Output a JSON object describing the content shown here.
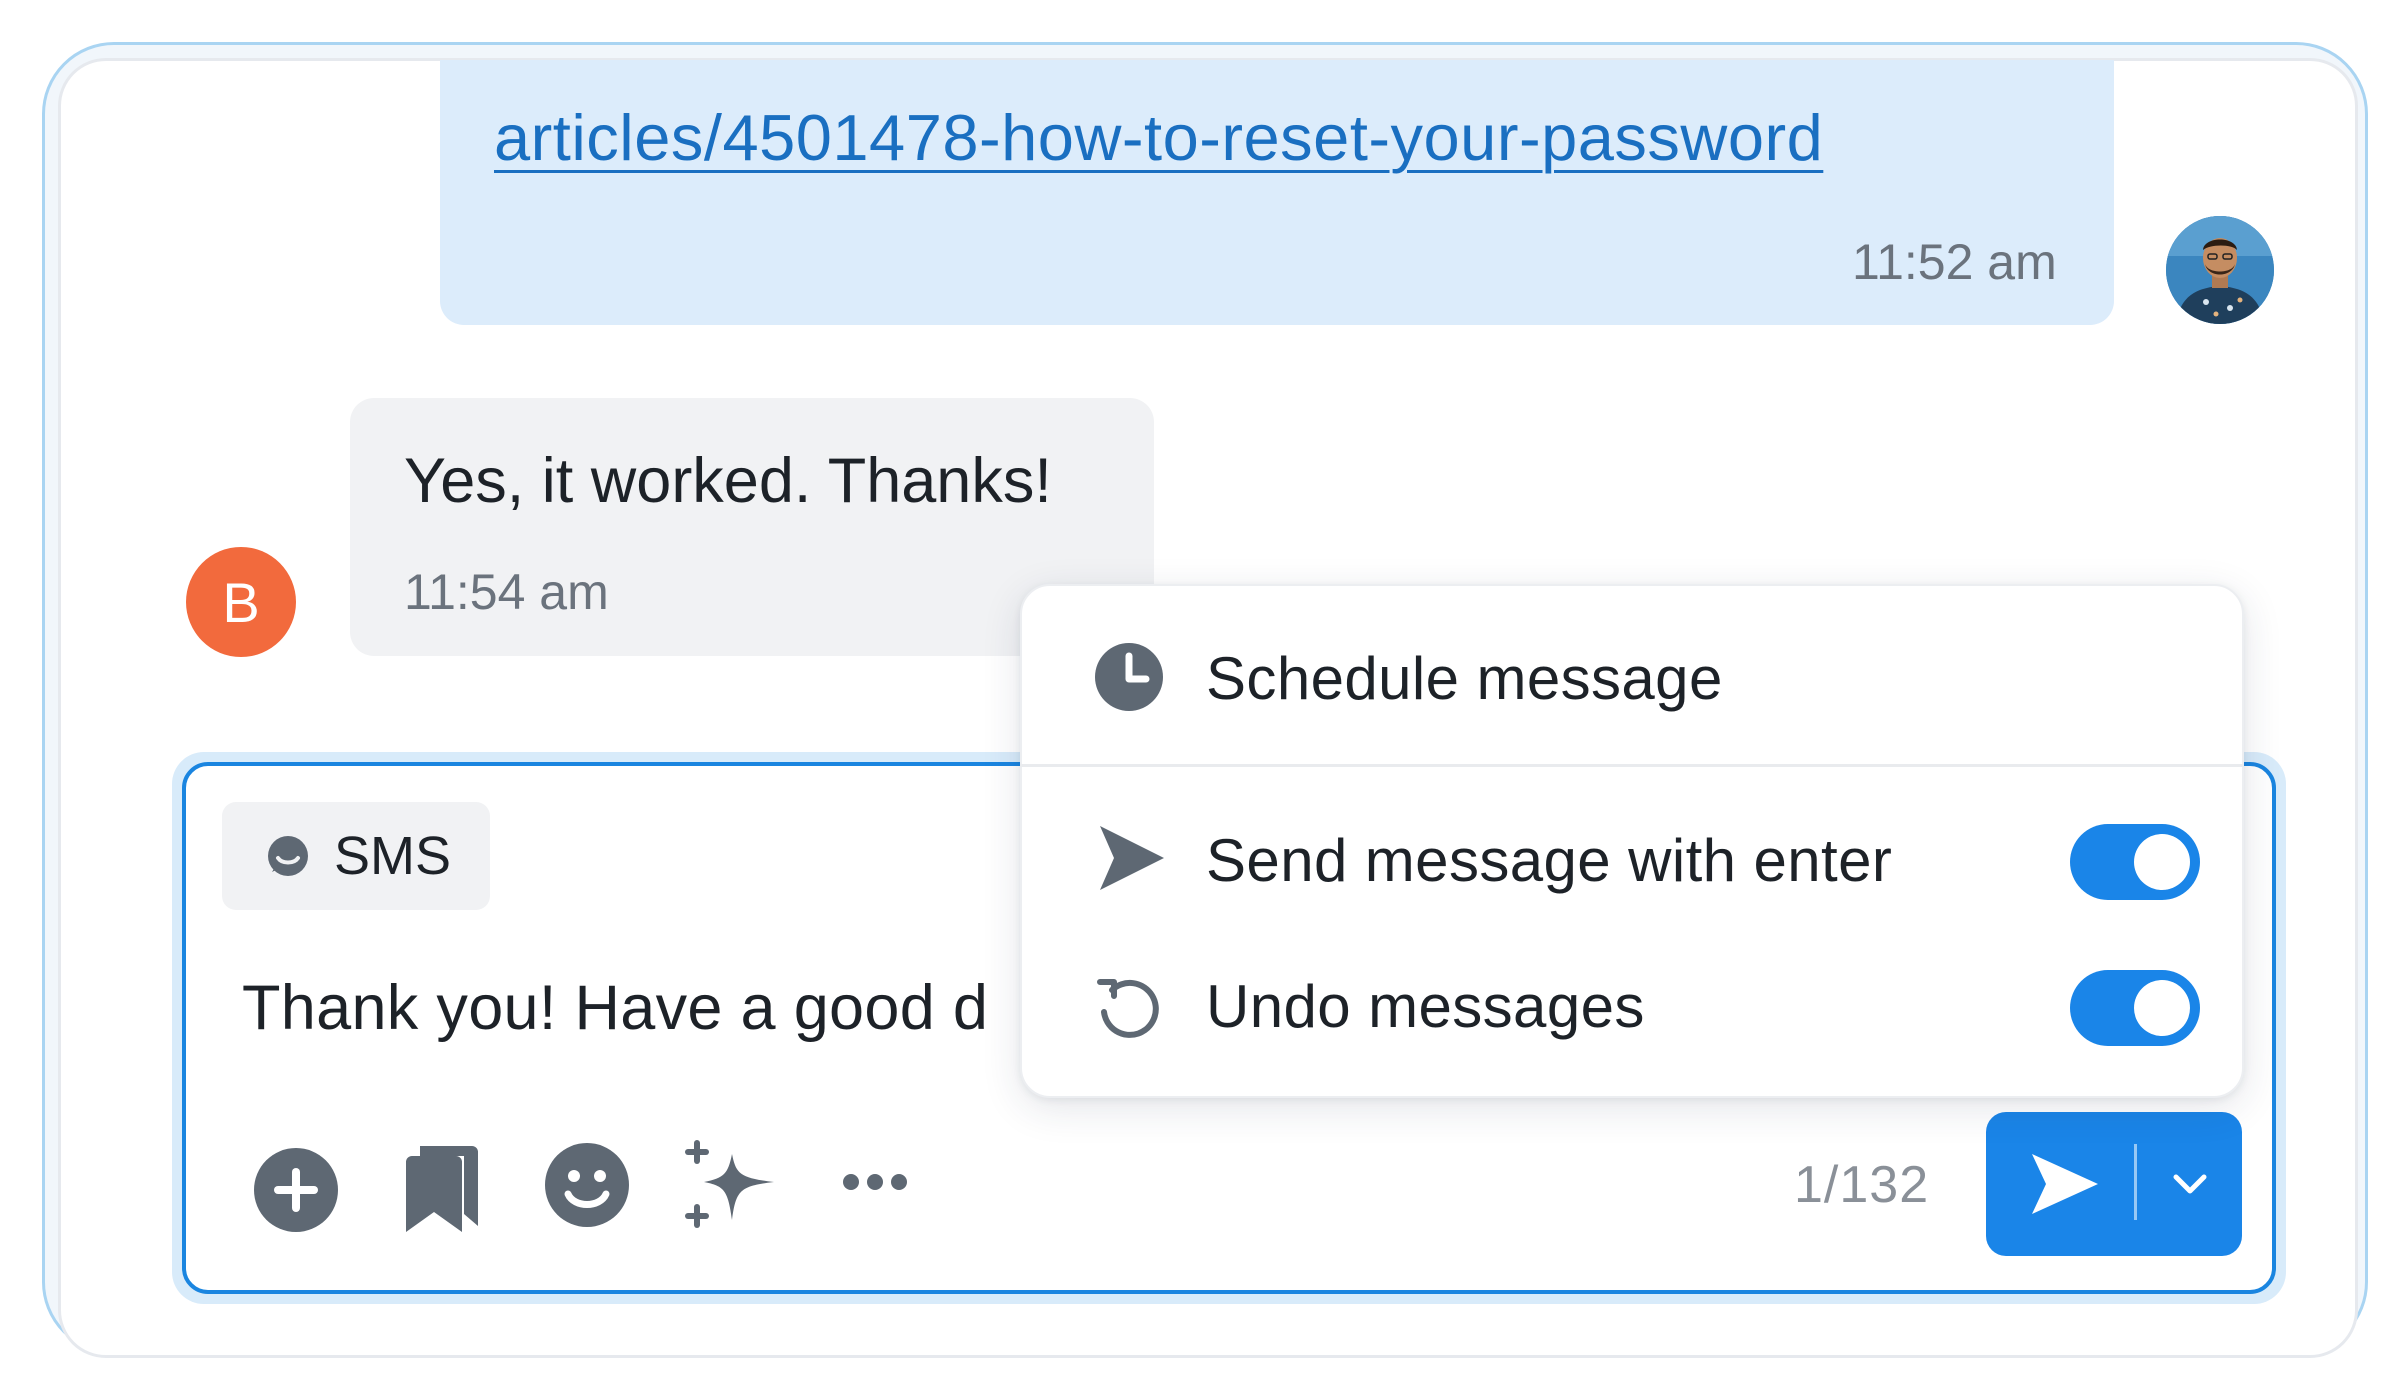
{
  "colors": {
    "accent": "#1a85e8",
    "agent_bubble": "#dcecfb",
    "customer_bubble": "#f1f2f4",
    "customer_avatar": "#f26a3d",
    "frame_border": "#a9d4f2"
  },
  "conversation": {
    "agent_message": {
      "link_text": "articles/4501478-how-to-reset-your-password",
      "time": "11:52 am",
      "avatar": "agent-photo"
    },
    "customer_message": {
      "text": "Yes, it worked. Thanks!",
      "time": "11:54 am",
      "avatar_initial": "B"
    }
  },
  "composer": {
    "channel": {
      "label": "SMS",
      "icon": "chat-bubble-icon"
    },
    "draft_text": "Thank you! Have a good d",
    "toolbar": [
      {
        "name": "add-attachment",
        "icon": "plus-circle-icon"
      },
      {
        "name": "saved-replies",
        "icon": "bookmarks-icon"
      },
      {
        "name": "emoji",
        "icon": "smiley-icon"
      },
      {
        "name": "ai-assist",
        "icon": "sparkles-icon"
      },
      {
        "name": "more",
        "icon": "ellipsis-icon"
      }
    ],
    "char_count": "1/132",
    "send_icon": "send-icon",
    "dropdown_icon": "chevron-down-icon"
  },
  "send_menu": {
    "items": [
      {
        "label": "Schedule message",
        "icon": "clock-icon"
      },
      {
        "label": "Send message with enter",
        "icon": "send-icon",
        "toggle_on": true
      },
      {
        "label": "Undo messages",
        "icon": "undo-icon",
        "toggle_on": true
      }
    ]
  }
}
